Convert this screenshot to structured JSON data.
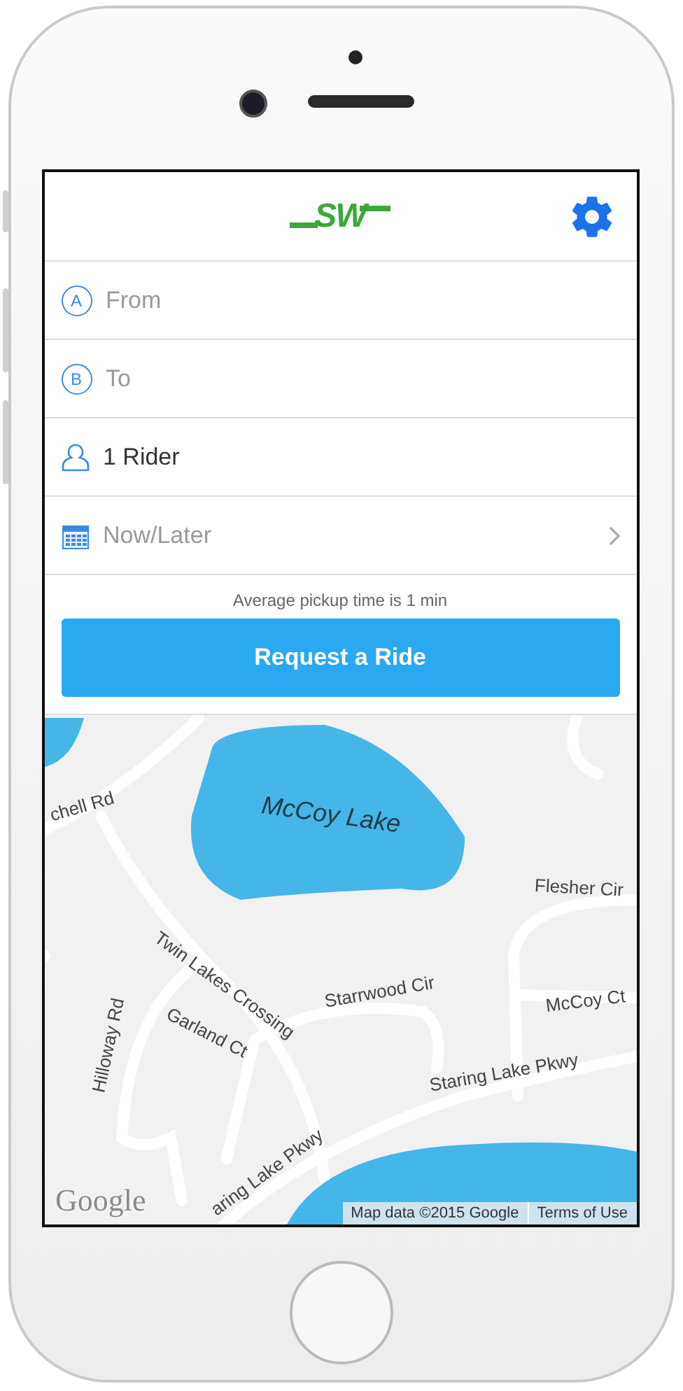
{
  "header": {
    "logo": "SW"
  },
  "fields": [
    {
      "kind": "location",
      "badge": "A",
      "placeholder": "From"
    },
    {
      "kind": "location",
      "badge": "B",
      "placeholder": "To"
    },
    {
      "kind": "riders",
      "value": "1 Rider"
    },
    {
      "kind": "schedule",
      "placeholder": "Now/Later"
    }
  ],
  "pickup_note": "Average pickup time is 1 min",
  "request_button": "Request a Ride",
  "map": {
    "labels": [
      {
        "kind": "road",
        "text": "chell Rd"
      },
      {
        "kind": "lake",
        "text": "McCoy Lake"
      },
      {
        "kind": "road",
        "text": "Flesher Cir"
      },
      {
        "kind": "road",
        "text": "Twin Lakes Crossing"
      },
      {
        "kind": "road",
        "text": "Starrwood Cir"
      },
      {
        "kind": "road",
        "text": "Garland Ct"
      },
      {
        "kind": "road",
        "text": "McCoy Ct"
      },
      {
        "kind": "road",
        "text": "Hilloway Rd"
      },
      {
        "kind": "road",
        "text": "Staring Lake Pkwy"
      },
      {
        "kind": "road",
        "text": "aring Lake Pkwy"
      }
    ],
    "provider_logo": "Google",
    "attribution": "Map data ©2015 Google",
    "terms_link": "Terms of Use"
  }
}
